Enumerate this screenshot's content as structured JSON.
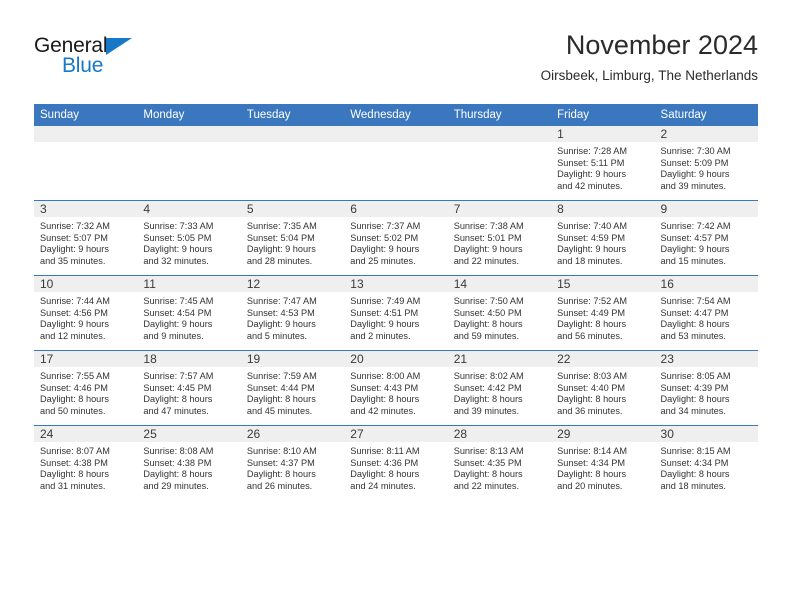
{
  "brand": {
    "name_part1": "General",
    "name_part2": "Blue",
    "triangle_color": "#1878c8",
    "text_color": "#1a1a1a"
  },
  "header": {
    "title": "November 2024",
    "subtitle": "Oirsbeek, Limburg, The Netherlands"
  },
  "theme": {
    "header_blue": "#3b77bf",
    "daynum_gray": "#efefef",
    "text_color": "#333333"
  },
  "weekdays": [
    "Sunday",
    "Monday",
    "Tuesday",
    "Wednesday",
    "Thursday",
    "Friday",
    "Saturday"
  ],
  "weeks": [
    [
      {
        "day": "",
        "sunrise": "",
        "sunset": "",
        "daylight_line1": "",
        "daylight_line2": ""
      },
      {
        "day": "",
        "sunrise": "",
        "sunset": "",
        "daylight_line1": "",
        "daylight_line2": ""
      },
      {
        "day": "",
        "sunrise": "",
        "sunset": "",
        "daylight_line1": "",
        "daylight_line2": ""
      },
      {
        "day": "",
        "sunrise": "",
        "sunset": "",
        "daylight_line1": "",
        "daylight_line2": ""
      },
      {
        "day": "",
        "sunrise": "",
        "sunset": "",
        "daylight_line1": "",
        "daylight_line2": ""
      },
      {
        "day": "1",
        "sunrise": "Sunrise: 7:28 AM",
        "sunset": "Sunset: 5:11 PM",
        "daylight_line1": "Daylight: 9 hours",
        "daylight_line2": "and 42 minutes."
      },
      {
        "day": "2",
        "sunrise": "Sunrise: 7:30 AM",
        "sunset": "Sunset: 5:09 PM",
        "daylight_line1": "Daylight: 9 hours",
        "daylight_line2": "and 39 minutes."
      }
    ],
    [
      {
        "day": "3",
        "sunrise": "Sunrise: 7:32 AM",
        "sunset": "Sunset: 5:07 PM",
        "daylight_line1": "Daylight: 9 hours",
        "daylight_line2": "and 35 minutes."
      },
      {
        "day": "4",
        "sunrise": "Sunrise: 7:33 AM",
        "sunset": "Sunset: 5:05 PM",
        "daylight_line1": "Daylight: 9 hours",
        "daylight_line2": "and 32 minutes."
      },
      {
        "day": "5",
        "sunrise": "Sunrise: 7:35 AM",
        "sunset": "Sunset: 5:04 PM",
        "daylight_line1": "Daylight: 9 hours",
        "daylight_line2": "and 28 minutes."
      },
      {
        "day": "6",
        "sunrise": "Sunrise: 7:37 AM",
        "sunset": "Sunset: 5:02 PM",
        "daylight_line1": "Daylight: 9 hours",
        "daylight_line2": "and 25 minutes."
      },
      {
        "day": "7",
        "sunrise": "Sunrise: 7:38 AM",
        "sunset": "Sunset: 5:01 PM",
        "daylight_line1": "Daylight: 9 hours",
        "daylight_line2": "and 22 minutes."
      },
      {
        "day": "8",
        "sunrise": "Sunrise: 7:40 AM",
        "sunset": "Sunset: 4:59 PM",
        "daylight_line1": "Daylight: 9 hours",
        "daylight_line2": "and 18 minutes."
      },
      {
        "day": "9",
        "sunrise": "Sunrise: 7:42 AM",
        "sunset": "Sunset: 4:57 PM",
        "daylight_line1": "Daylight: 9 hours",
        "daylight_line2": "and 15 minutes."
      }
    ],
    [
      {
        "day": "10",
        "sunrise": "Sunrise: 7:44 AM",
        "sunset": "Sunset: 4:56 PM",
        "daylight_line1": "Daylight: 9 hours",
        "daylight_line2": "and 12 minutes."
      },
      {
        "day": "11",
        "sunrise": "Sunrise: 7:45 AM",
        "sunset": "Sunset: 4:54 PM",
        "daylight_line1": "Daylight: 9 hours",
        "daylight_line2": "and 9 minutes."
      },
      {
        "day": "12",
        "sunrise": "Sunrise: 7:47 AM",
        "sunset": "Sunset: 4:53 PM",
        "daylight_line1": "Daylight: 9 hours",
        "daylight_line2": "and 5 minutes."
      },
      {
        "day": "13",
        "sunrise": "Sunrise: 7:49 AM",
        "sunset": "Sunset: 4:51 PM",
        "daylight_line1": "Daylight: 9 hours",
        "daylight_line2": "and 2 minutes."
      },
      {
        "day": "14",
        "sunrise": "Sunrise: 7:50 AM",
        "sunset": "Sunset: 4:50 PM",
        "daylight_line1": "Daylight: 8 hours",
        "daylight_line2": "and 59 minutes."
      },
      {
        "day": "15",
        "sunrise": "Sunrise: 7:52 AM",
        "sunset": "Sunset: 4:49 PM",
        "daylight_line1": "Daylight: 8 hours",
        "daylight_line2": "and 56 minutes."
      },
      {
        "day": "16",
        "sunrise": "Sunrise: 7:54 AM",
        "sunset": "Sunset: 4:47 PM",
        "daylight_line1": "Daylight: 8 hours",
        "daylight_line2": "and 53 minutes."
      }
    ],
    [
      {
        "day": "17",
        "sunrise": "Sunrise: 7:55 AM",
        "sunset": "Sunset: 4:46 PM",
        "daylight_line1": "Daylight: 8 hours",
        "daylight_line2": "and 50 minutes."
      },
      {
        "day": "18",
        "sunrise": "Sunrise: 7:57 AM",
        "sunset": "Sunset: 4:45 PM",
        "daylight_line1": "Daylight: 8 hours",
        "daylight_line2": "and 47 minutes."
      },
      {
        "day": "19",
        "sunrise": "Sunrise: 7:59 AM",
        "sunset": "Sunset: 4:44 PM",
        "daylight_line1": "Daylight: 8 hours",
        "daylight_line2": "and 45 minutes."
      },
      {
        "day": "20",
        "sunrise": "Sunrise: 8:00 AM",
        "sunset": "Sunset: 4:43 PM",
        "daylight_line1": "Daylight: 8 hours",
        "daylight_line2": "and 42 minutes."
      },
      {
        "day": "21",
        "sunrise": "Sunrise: 8:02 AM",
        "sunset": "Sunset: 4:42 PM",
        "daylight_line1": "Daylight: 8 hours",
        "daylight_line2": "and 39 minutes."
      },
      {
        "day": "22",
        "sunrise": "Sunrise: 8:03 AM",
        "sunset": "Sunset: 4:40 PM",
        "daylight_line1": "Daylight: 8 hours",
        "daylight_line2": "and 36 minutes."
      },
      {
        "day": "23",
        "sunrise": "Sunrise: 8:05 AM",
        "sunset": "Sunset: 4:39 PM",
        "daylight_line1": "Daylight: 8 hours",
        "daylight_line2": "and 34 minutes."
      }
    ],
    [
      {
        "day": "24",
        "sunrise": "Sunrise: 8:07 AM",
        "sunset": "Sunset: 4:38 PM",
        "daylight_line1": "Daylight: 8 hours",
        "daylight_line2": "and 31 minutes."
      },
      {
        "day": "25",
        "sunrise": "Sunrise: 8:08 AM",
        "sunset": "Sunset: 4:38 PM",
        "daylight_line1": "Daylight: 8 hours",
        "daylight_line2": "and 29 minutes."
      },
      {
        "day": "26",
        "sunrise": "Sunrise: 8:10 AM",
        "sunset": "Sunset: 4:37 PM",
        "daylight_line1": "Daylight: 8 hours",
        "daylight_line2": "and 26 minutes."
      },
      {
        "day": "27",
        "sunrise": "Sunrise: 8:11 AM",
        "sunset": "Sunset: 4:36 PM",
        "daylight_line1": "Daylight: 8 hours",
        "daylight_line2": "and 24 minutes."
      },
      {
        "day": "28",
        "sunrise": "Sunrise: 8:13 AM",
        "sunset": "Sunset: 4:35 PM",
        "daylight_line1": "Daylight: 8 hours",
        "daylight_line2": "and 22 minutes."
      },
      {
        "day": "29",
        "sunrise": "Sunrise: 8:14 AM",
        "sunset": "Sunset: 4:34 PM",
        "daylight_line1": "Daylight: 8 hours",
        "daylight_line2": "and 20 minutes."
      },
      {
        "day": "30",
        "sunrise": "Sunrise: 8:15 AM",
        "sunset": "Sunset: 4:34 PM",
        "daylight_line1": "Daylight: 8 hours",
        "daylight_line2": "and 18 minutes."
      }
    ]
  ]
}
